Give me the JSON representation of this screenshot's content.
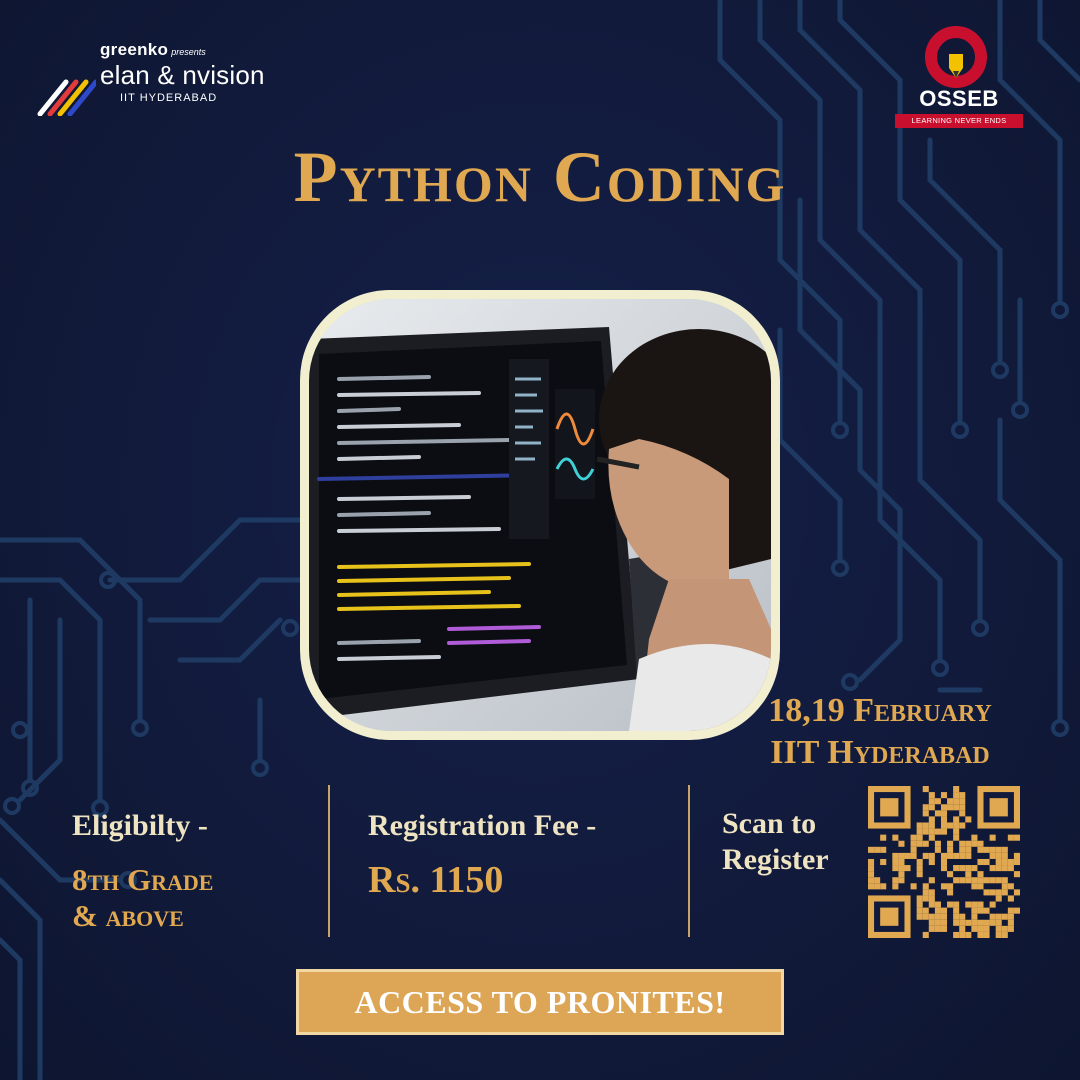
{
  "colors": {
    "background": "#111a3a",
    "circuit": "#1e3a63",
    "gold": "#e0a850",
    "cream": "#efe4c2",
    "button": "#dda657",
    "osseb_red": "#c8102e"
  },
  "sponsor_logo": {
    "brand": "greenko",
    "presents": "presents",
    "event": "elan & nvision",
    "institute": "IIT HYDERABAD"
  },
  "partner_logo": {
    "name": "OSSEB",
    "tagline": "LEARNING NEVER ENDS"
  },
  "title": "Python Coding",
  "photo": {
    "icon": "person-coding-at-monitor-photo"
  },
  "event_info": {
    "dates": "18,19 February",
    "venue": "IIT Hyderabad"
  },
  "eligibility": {
    "label": "Eligibilty -",
    "value_line1": "8th Grade",
    "value_line2": "& above"
  },
  "registration": {
    "label": "Registration Fee -",
    "value": "Rs. 1150"
  },
  "scan": {
    "line1": "Scan to",
    "line2": "Register",
    "icon": "qr-code-icon"
  },
  "cta": {
    "label": "ACCESS TO PRONITES!"
  }
}
